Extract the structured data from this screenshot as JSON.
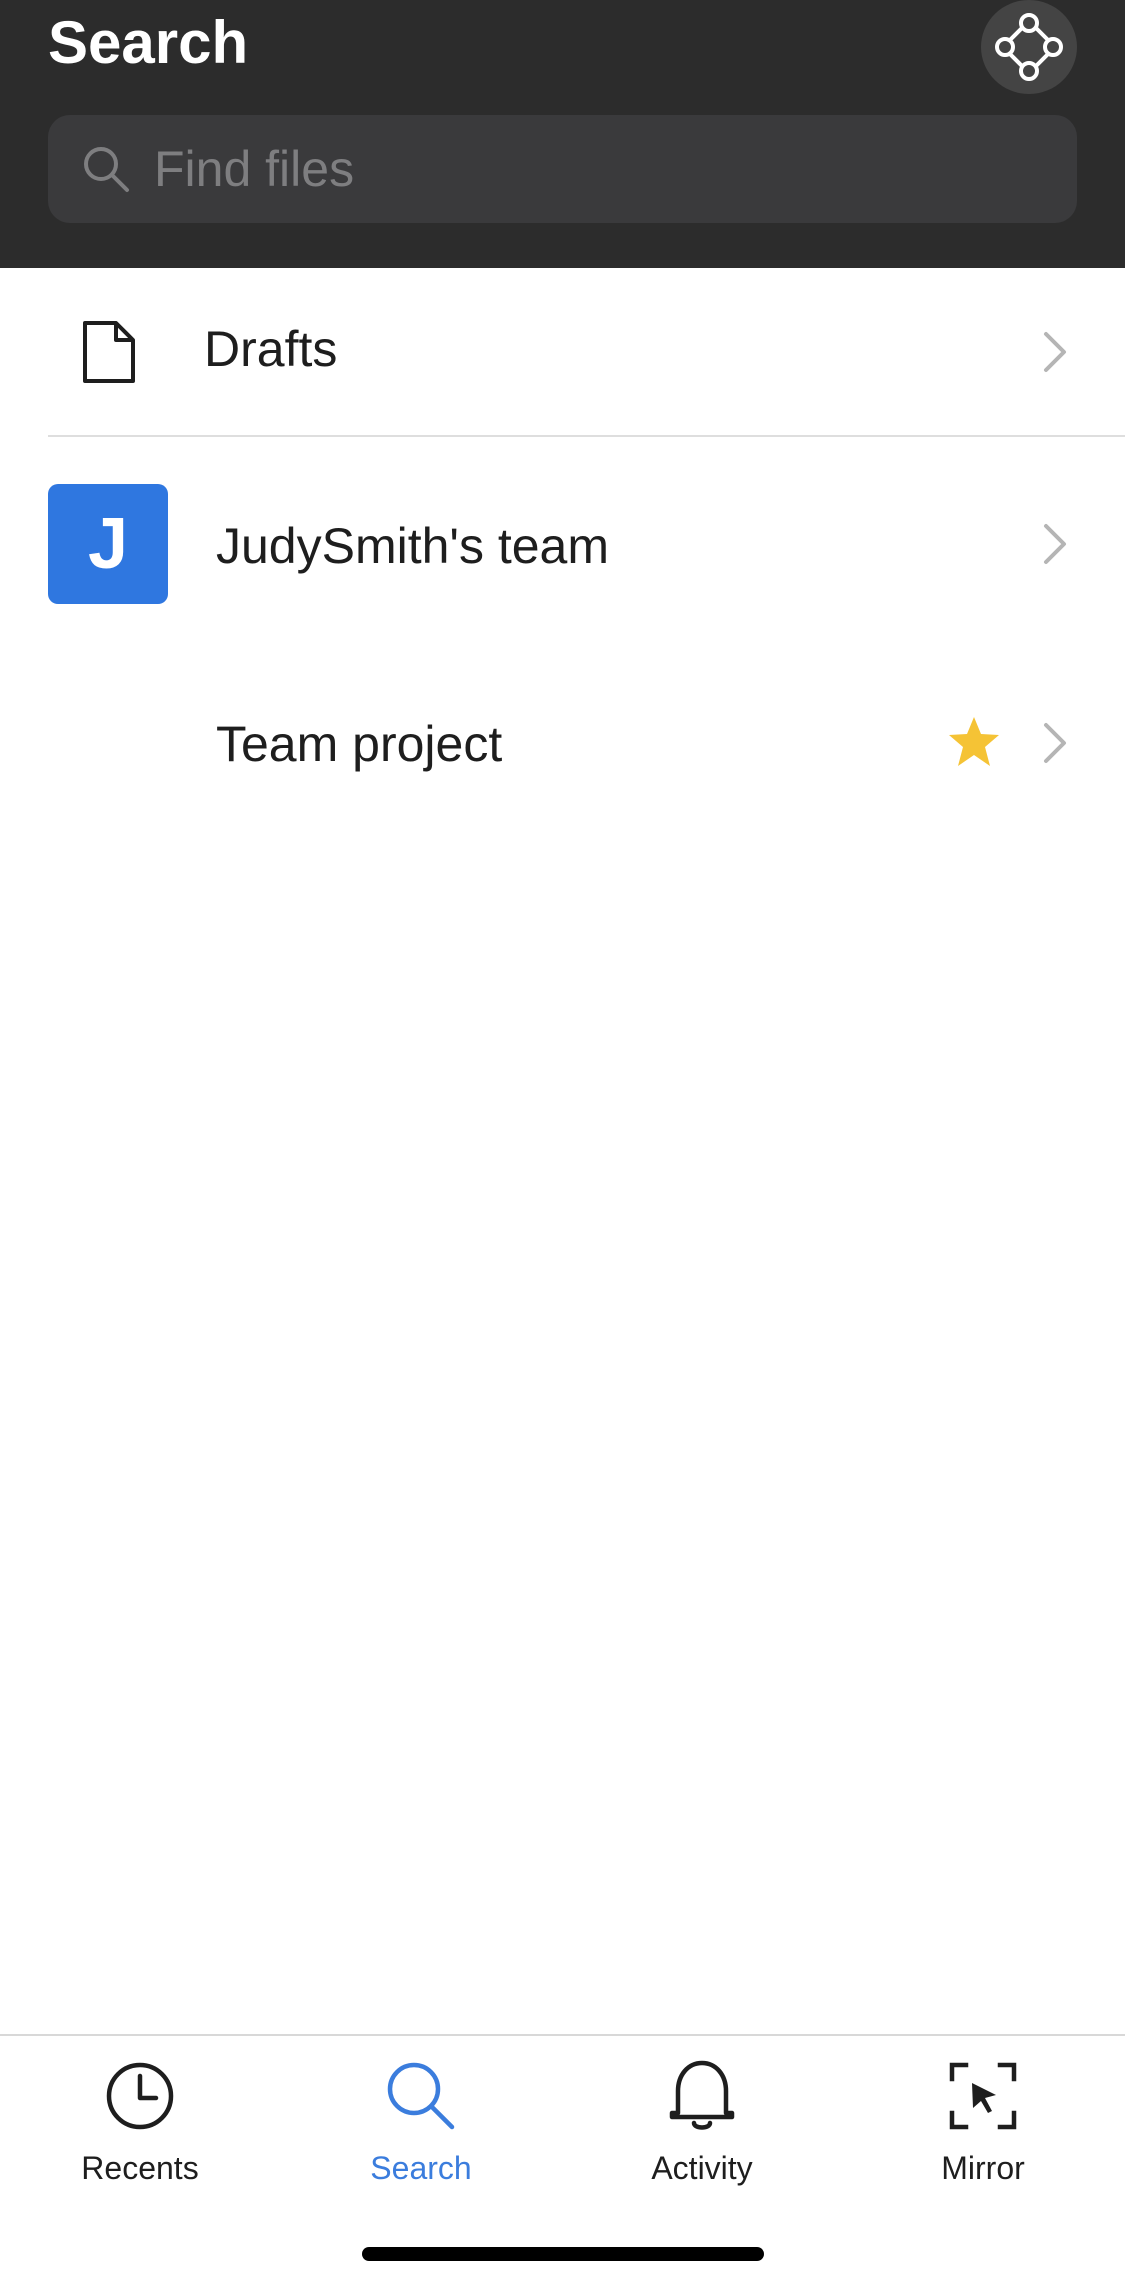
{
  "header": {
    "title": "Search",
    "component_button_icon": "component-icon",
    "search": {
      "placeholder": "Find files",
      "icon": "search-icon"
    }
  },
  "list": {
    "drafts": {
      "label": "Drafts",
      "icon": "file-icon"
    },
    "team": {
      "avatar_letter": "J",
      "label": "JudySmith's team",
      "avatar_color": "#2f77e0"
    },
    "project": {
      "label": "Team project",
      "starred": true,
      "star_color": "#f5c335"
    }
  },
  "tabbar": {
    "tabs": [
      {
        "label": "Recents",
        "icon": "clock-icon",
        "active": false
      },
      {
        "label": "Search",
        "icon": "search-icon",
        "active": true
      },
      {
        "label": "Activity",
        "icon": "bell-icon",
        "active": false
      },
      {
        "label": "Mirror",
        "icon": "mirror-icon",
        "active": false
      }
    ],
    "active_color": "#3b7ddd"
  }
}
